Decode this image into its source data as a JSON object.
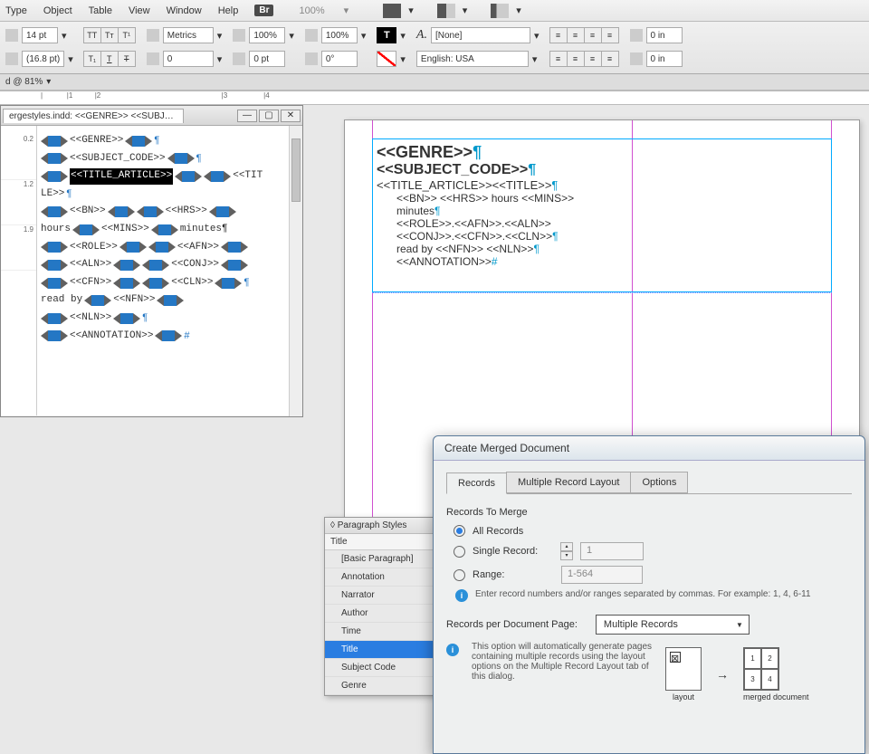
{
  "menubar": {
    "items": [
      "Type",
      "Object",
      "Table",
      "View",
      "Window",
      "Help"
    ],
    "br": "Br",
    "zoom": "100%"
  },
  "control": {
    "fontSize": "14 pt",
    "leading": "(16.8 pt)",
    "kerning": "Metrics",
    "tracking": "0",
    "hscale": "100%",
    "vscale": "100%",
    "baseline": "0 pt",
    "skew": "0°",
    "charstyle": "[None]",
    "lang": "English: USA",
    "indent": "0 in",
    "indentR": "0 in"
  },
  "zoomBar": "d @ 81%",
  "docTab": "ergestyles.indd: <<GENRE>> <<SUBJECT...",
  "rulerLeft": [
    "0.2",
    "1.2",
    "1.9"
  ],
  "storyRows": [
    {
      "fields": [
        "<<GENRE>>"
      ],
      "tail": "¶"
    },
    {
      "fields": [
        "<<SUBJECT_CODE>>"
      ],
      "tail": "¶"
    },
    {
      "fields": [
        "<<TITLE_ARTICLE>>"
      ],
      "highlighted": true,
      "extra": " <<TIT"
    },
    {
      "text": "LE>>",
      "fields2": [],
      "tail": "¶"
    },
    {
      "fields": [
        "<<BN>>",
        "<<HRS>>"
      ],
      "tail": ""
    },
    {
      "text": "hours ",
      "fields2": [
        "<<MINS>>"
      ],
      "plain": " minutes¶"
    },
    {
      "fields": [
        "<<ROLE>>",
        "<<AFN>>"
      ],
      "tail": ""
    },
    {
      "fields": [
        "<<ALN>>",
        "<<CONJ>>"
      ],
      "tail": ""
    },
    {
      "fields": [
        "<<CFN>>",
        "<<CLN>>"
      ],
      "tail": "¶"
    },
    {
      "text": "read by ",
      "fields2": [
        "<<NFN>>"
      ],
      "tail": ""
    },
    {
      "fields": [
        "<<NLN>>"
      ],
      "tail": "¶"
    },
    {
      "fields": [
        "<<ANNOTATION>>"
      ],
      "tail": "#"
    }
  ],
  "pageLines": {
    "l1": "<<GENRE>>",
    "l2": "<<SUBJECT_CODE>>",
    "l3": "<<TITLE_ARTICLE>><<TITLE>>",
    "l4a": "<<BN>> <<HRS>> hours <<MINS>>",
    "l4b": "minutes",
    "l4c": "<<ROLE>>.<<AFN>>.<<ALN>>",
    "l4d": "<<CONJ>>.<<CFN>>.<<CLN>>",
    "l4e": "read by <<NFN>> <<NLN>>",
    "l4f": "<<ANNOTATION>>"
  },
  "paragraphPanel": {
    "title": "◊ Paragraph Styles",
    "current": "Title",
    "styles": [
      "[Basic Paragraph]",
      "Annotation",
      "Narrator",
      "Author",
      "Time",
      "Title",
      "Subject Code",
      "Genre"
    ],
    "selected": "Title"
  },
  "dialog": {
    "title": "Create Merged Document",
    "tabs": [
      "Records",
      "Multiple Record Layout",
      "Options"
    ],
    "activeTab": "Records",
    "group1": "Records To Merge",
    "optAll": "All Records",
    "optSingle": "Single Record:",
    "singleVal": "1",
    "optRange": "Range:",
    "rangeVal": "1-564",
    "hint1": "Enter record numbers and/or ranges separated by commas. For example: 1, 4, 6-11",
    "group2Label": "Records per Document Page:",
    "dropdown": "Multiple Records",
    "hint2": "This option will automatically generate pages containing multiple records using the layout options on the Multiple Record Layout tab of this dialog.",
    "diagLabelL": "layout",
    "diagLabelR": "merged document",
    "gridNums": [
      "1",
      "2",
      "3",
      "4"
    ]
  }
}
